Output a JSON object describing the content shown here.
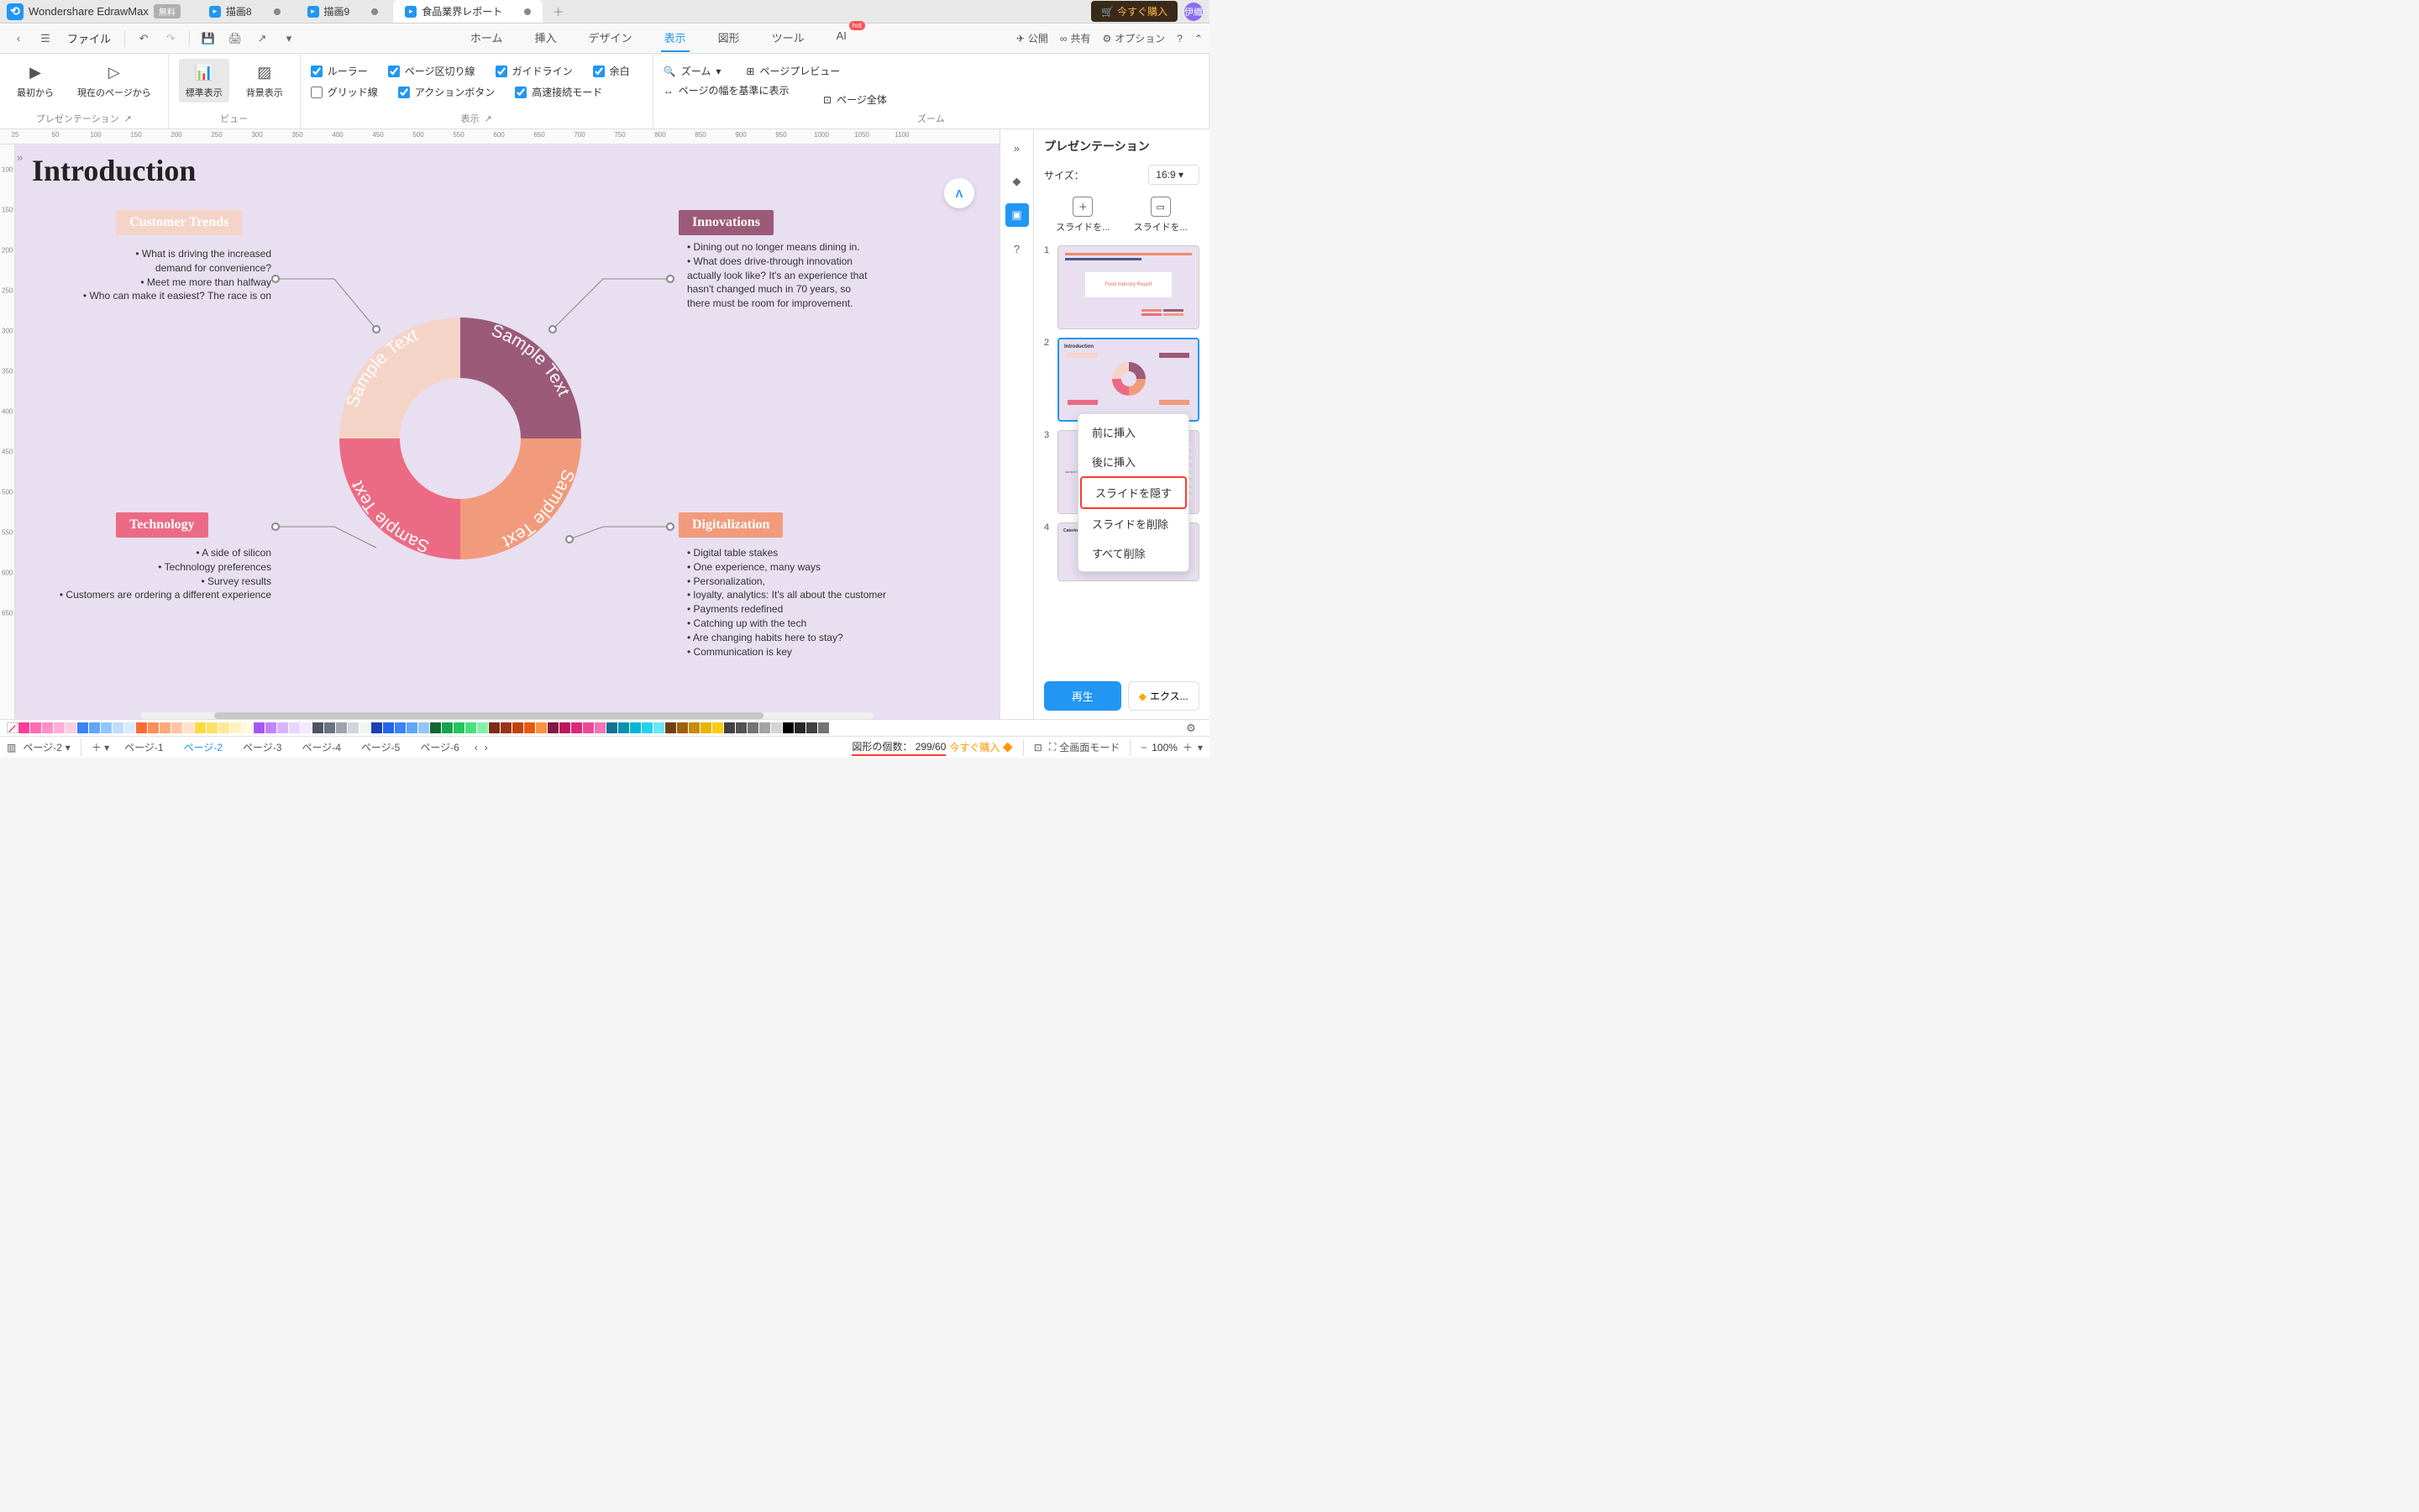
{
  "app": {
    "name": "Wondershare EdrawMax",
    "free_badge": "無料",
    "buy_now": "今すぐ購入",
    "avatar": "伊織"
  },
  "docTabs": [
    {
      "label": "描画8",
      "dirty": true,
      "active": false
    },
    {
      "label": "描画9",
      "dirty": true,
      "active": false
    },
    {
      "label": "食品業界レポート",
      "dirty": true,
      "active": true
    }
  ],
  "fileMenu": "ファイル",
  "mainMenu": [
    "ホーム",
    "挿入",
    "デザイン",
    "表示",
    "図形",
    "ツール",
    "AI"
  ],
  "mainMenuActive": "表示",
  "rightTools": {
    "publish": "公開",
    "share": "共有",
    "options": "オプション"
  },
  "ribbon": {
    "presentation": {
      "from_start": "最初から",
      "from_current": "現在のページから",
      "label": "プレゼンテーション"
    },
    "view": {
      "standard": "標準表示",
      "background": "背景表示",
      "label": "ビュー"
    },
    "display": {
      "ruler": "ルーラー",
      "page_break": "ページ区切り線",
      "guideline": "ガイドライン",
      "margin": "余白",
      "grid": "グリッド線",
      "action_button": "アクションボタン",
      "quick_connect": "高速接続モード",
      "label": "表示"
    },
    "zoom": {
      "zoom": "ズーム",
      "fit_width": "ページの幅を基準に表示",
      "preview": "ページプレビュー",
      "whole_page": "ページ全体",
      "label": "ズーム"
    }
  },
  "rulerH": [
    25,
    50,
    100,
    150,
    200,
    250,
    300,
    350,
    400,
    450,
    500,
    550,
    600,
    650,
    700,
    750,
    800,
    850,
    900,
    950,
    1000,
    1050,
    1100
  ],
  "rulerV": [
    100,
    150,
    200,
    250,
    300,
    350,
    400,
    450,
    500,
    550,
    600,
    650
  ],
  "canvas": {
    "title": "Introduction",
    "topics": {
      "customer_trends": {
        "label": "Customer Trends",
        "bullets": "• What is driving the increased\ndemand for convenience?\n• Meet me more than halfway\n• Who can make it easiest? The race is on"
      },
      "innovations": {
        "label": "Innovations",
        "bullets": "• Dining out no longer means dining in.\n• What does drive-through innovation\nactually look like? It's an experience that\nhasn't changed much in 70 years, so\nthere must be room for improvement."
      },
      "technology": {
        "label": "Technology",
        "bullets": "• A side of silicon\n• Technology preferences\n• Survey results\n• Customers are ordering a different experience"
      },
      "digitalization": {
        "label": "Digitalization",
        "bullets": "• Digital table stakes\n• One experience, many ways\n• Personalization,\n• loyalty, analytics: It's all about the customer\n• Payments redefined\n• Catching up with the tech\n• Are changing habits here to stay?\n• Communication is key"
      }
    },
    "donut_labels": [
      "Sample Text",
      "Sample Text",
      "Sample Text",
      "Sample Text"
    ]
  },
  "rightPanel": {
    "title": "プレゼンテーション",
    "size_label": "サイズ：",
    "size_value": "16:9",
    "add_slide": "スライドを...",
    "add_slide2": "スライドを...",
    "play": "再生",
    "export": "エクス...",
    "slides": [
      {
        "num": "1",
        "title": "Food Industry Report"
      },
      {
        "num": "2",
        "title": "Introduction"
      },
      {
        "num": "3",
        "title": ""
      },
      {
        "num": "4",
        "title": "Catering to Convenience"
      }
    ]
  },
  "contextMenu": {
    "insert_before": "前に挿入",
    "insert_after": "後に挿入",
    "hide_slide": "スライドを隠す",
    "delete_slide": "スライドを削除",
    "delete_all": "すべて削除"
  },
  "statusbar": {
    "page_dropdown": "ページ-2",
    "pages": [
      "ページ-1",
      "ページ-2",
      "ページ-3",
      "ページ-4",
      "ページ-5",
      "ページ-6"
    ],
    "active_page": "ページ-2",
    "shape_count_label": "図形の個数：",
    "shape_count_value": "299/60",
    "buy_now": "今すぐ購入",
    "fullscreen": "全画面モード",
    "zoom": "100%"
  },
  "colors": [
    "#ff3b9a",
    "#ff6bb5",
    "#ff8ec9",
    "#ffaed9",
    "#ffcce8",
    "#3b82f6",
    "#60a5fa",
    "#93c5fd",
    "#bfdbfe",
    "#dbeafe",
    "#ff6b35",
    "#ff8c5a",
    "#ffa97d",
    "#ffc5a3",
    "#ffe0cc",
    "#ffd93d",
    "#ffe066",
    "#ffe999",
    "#fff2bf",
    "#fff9e0",
    "#a855f7",
    "#c084fc",
    "#d8b4fe",
    "#e9d5ff",
    "#f3e8ff",
    "#4b5563",
    "#6b7280",
    "#9ca3af",
    "#d1d5db",
    "#f3f4f6",
    "#1e40af",
    "#2563eb",
    "#3b82f6",
    "#60a5fa",
    "#93c5fd",
    "#166534",
    "#16a34a",
    "#22c55e",
    "#4ade80",
    "#86efac",
    "#7c2d12",
    "#9a3412",
    "#c2410c",
    "#ea580c",
    "#fb923c",
    "#831843",
    "#be185d",
    "#db2777",
    "#ec4899",
    "#f472b6",
    "#0e7490",
    "#0891b2",
    "#06b6d4",
    "#22d3ee",
    "#67e8f9",
    "#713f12",
    "#a16207",
    "#ca8a04",
    "#eab308",
    "#facc15",
    "#404040",
    "#525252",
    "#737373",
    "#a3a3a3",
    "#d4d4d4",
    "#000000",
    "#262626",
    "#404040",
    "#737373",
    "#ffffff"
  ]
}
